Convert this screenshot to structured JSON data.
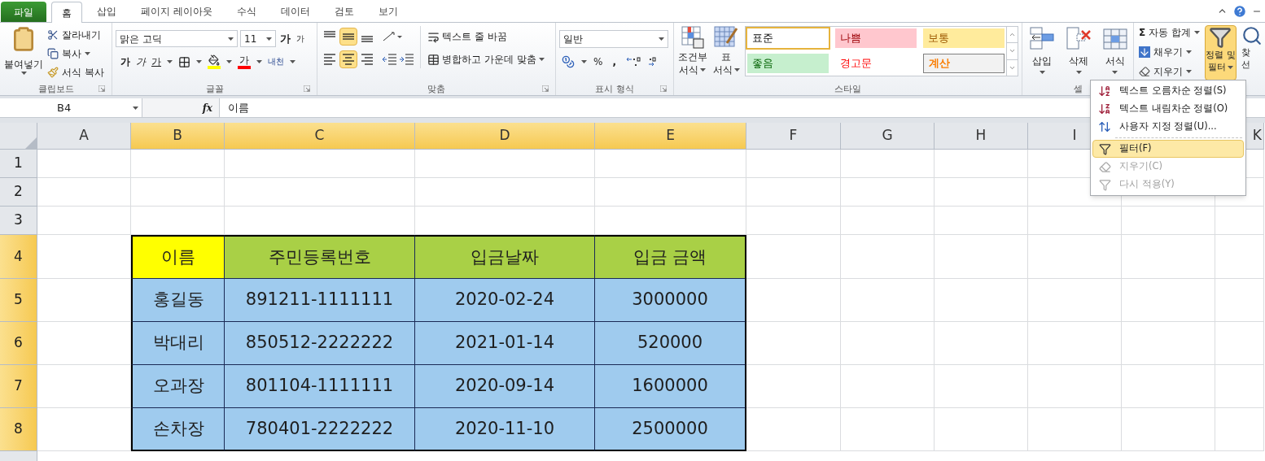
{
  "tabs": [
    {
      "label": "파일",
      "kind": "file",
      "selected": false
    },
    {
      "label": "홈",
      "kind": "tab",
      "selected": true
    },
    {
      "label": "삽입",
      "kind": "tab",
      "selected": false
    },
    {
      "label": "페이지 레이아웃",
      "kind": "tab",
      "selected": false
    },
    {
      "label": "수식",
      "kind": "tab",
      "selected": false
    },
    {
      "label": "데이터",
      "kind": "tab",
      "selected": false
    },
    {
      "label": "검토",
      "kind": "tab",
      "selected": false
    },
    {
      "label": "보기",
      "kind": "tab",
      "selected": false
    }
  ],
  "ribbon": {
    "clipboard": {
      "label": "클립보드",
      "paste": "붙여넣기",
      "cut": "잘라내기",
      "copy": "복사",
      "format_painter": "서식 복사"
    },
    "font": {
      "label": "글꼴",
      "font_name": "맑은 고딕",
      "font_size": "11",
      "grow": "가",
      "shrink": "가",
      "bold": "가",
      "italic": "가",
      "underline": "가",
      "font_color": "가",
      "phonetic": "내천"
    },
    "alignment": {
      "label": "맞춤",
      "wrap_text": "텍스트 줄 바꿈",
      "merge_center": "병합하고 가운데 맞춤",
      "vertical": [
        {
          "kind": "top",
          "selected": false
        },
        {
          "kind": "middle",
          "selected": true
        },
        {
          "kind": "bottom",
          "selected": false
        }
      ],
      "horizontal": [
        {
          "kind": "left",
          "selected": false
        },
        {
          "kind": "center",
          "selected": true
        },
        {
          "kind": "right",
          "selected": false
        }
      ]
    },
    "number": {
      "label": "표시 형식",
      "format": "일반",
      "percent": "%",
      "comma": ","
    },
    "styles": {
      "label": "스타일",
      "conditional": [
        "조건부",
        "서식"
      ],
      "table_format": [
        "표",
        "서식"
      ],
      "gallery": [
        {
          "label": "표준",
          "kind": "normal",
          "selected": true
        },
        {
          "label": "나쁨",
          "kind": "bad",
          "selected": false
        },
        {
          "label": "보통",
          "kind": "neutral",
          "selected": false
        },
        {
          "label": "좋음",
          "kind": "good",
          "selected": false
        },
        {
          "label": "경고문",
          "kind": "warning",
          "selected": false
        },
        {
          "label": "계산",
          "kind": "calculation",
          "selected": false
        }
      ]
    },
    "cells": {
      "label": "셀",
      "buttons": [
        {
          "label": "삽입",
          "kind": "insert"
        },
        {
          "label": "삭제",
          "kind": "delete"
        },
        {
          "label": "서식",
          "kind": "format"
        }
      ]
    },
    "editing": {
      "autosum_symbol": "Σ",
      "autosum": "자동 합계",
      "fill": "채우기",
      "clear": "지우기",
      "sort_filter": [
        "정렬 및",
        "필터"
      ],
      "sort_filter_active": true,
      "find": [
        "찾",
        "선"
      ]
    }
  },
  "formula_bar": {
    "name_box": "B4",
    "fx": "fx",
    "value": "이름"
  },
  "sheet": {
    "columns": [
      {
        "label": "A",
        "selected": false
      },
      {
        "label": "B",
        "selected": true
      },
      {
        "label": "C",
        "selected": true
      },
      {
        "label": "D",
        "selected": true
      },
      {
        "label": "E",
        "selected": true
      },
      {
        "label": "F",
        "selected": false
      },
      {
        "label": "G",
        "selected": false
      },
      {
        "label": "H",
        "selected": false
      },
      {
        "label": "I",
        "selected": false
      },
      {
        "label": "K",
        "selected": false
      }
    ],
    "rows": [
      {
        "label": "1",
        "selected": false
      },
      {
        "label": "2",
        "selected": false
      },
      {
        "label": "3",
        "selected": false
      },
      {
        "label": "4",
        "selected": true
      },
      {
        "label": "5",
        "selected": true
      },
      {
        "label": "6",
        "selected": true
      },
      {
        "label": "7",
        "selected": true
      },
      {
        "label": "8",
        "selected": true
      }
    ]
  },
  "table": {
    "header": [
      {
        "text": "이름",
        "color": "#ffff00"
      },
      {
        "text": "주민등록번호",
        "color": "#a9d046"
      },
      {
        "text": "입금날짜",
        "color": "#a9d046"
      },
      {
        "text": "입금 금액",
        "color": "#a9d046"
      }
    ],
    "rows": [
      [
        "홍길동",
        "891211-1111111",
        "2020-02-24",
        "3000000"
      ],
      [
        "박대리",
        "850512-2222222",
        "2021-01-14",
        "520000"
      ],
      [
        "오과장",
        "801104-1111111",
        "2020-09-14",
        "1600000"
      ],
      [
        "손차장",
        "780401-2222222",
        "2020-11-10",
        "2500000"
      ]
    ]
  },
  "menu": [
    {
      "label": "텍스트 오름차순 정렬(S)",
      "kind": "sort_asc",
      "disabled": false,
      "selected": false
    },
    {
      "label": "텍스트 내림차순 정렬(O)",
      "kind": "sort_desc",
      "disabled": false,
      "selected": false
    },
    {
      "label": "사용자 지정 정렬(U)...",
      "kind": "custom_sort",
      "disabled": false,
      "selected": false
    },
    {
      "label": "필터(F)",
      "kind": "filter",
      "disabled": false,
      "selected": true
    },
    {
      "label": "지우기(C)",
      "kind": "clear",
      "disabled": true,
      "selected": false
    },
    {
      "label": "다시 적용(Y)",
      "kind": "reapply",
      "disabled": true,
      "selected": false
    }
  ]
}
